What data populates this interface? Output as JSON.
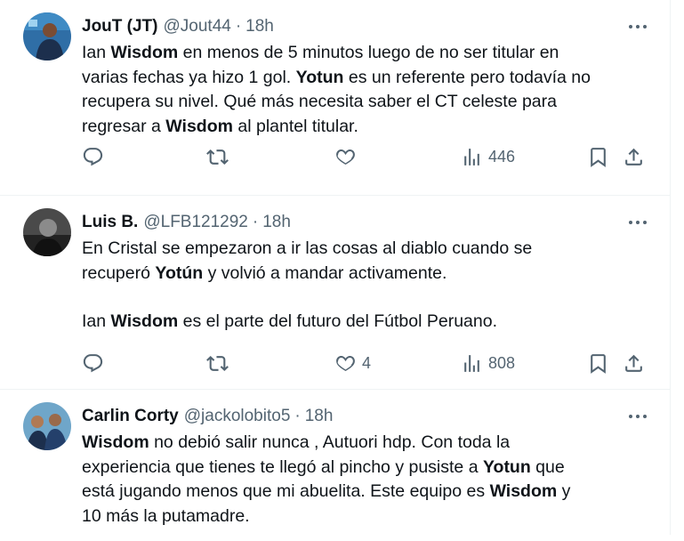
{
  "tweets": [
    {
      "name": "JouT (JT)",
      "handle": "@Jout44",
      "dot": "·",
      "time": "18h",
      "lines": [
        [
          {
            "t": "Ian "
          },
          {
            "b": "Wisdom"
          },
          {
            "t": " en menos de 5 minutos luego de no ser titular en"
          }
        ],
        [
          {
            "t": "varias fechas ya hizo 1 gol. "
          },
          {
            "b": "Yotun"
          },
          {
            "t": " es un referente pero todavía no"
          }
        ],
        [
          {
            "t": "recupera su nivel. Qué más necesita saber el CT celeste para"
          }
        ],
        [
          {
            "t": "regresar a "
          },
          {
            "b": "Wisdom"
          },
          {
            "t": " al plantel titular."
          }
        ]
      ],
      "likes": "",
      "views": "446"
    },
    {
      "name": "Luis B.",
      "handle": "@LFB121292",
      "dot": "·",
      "time": "18h",
      "lines": [
        [
          {
            "t": "En Cristal se empezaron a ir las cosas al diablo cuando se"
          }
        ],
        [
          {
            "t": "recuperó "
          },
          {
            "b": "Yotún"
          },
          {
            "t": " y volvió a mandar activamente."
          }
        ],
        [],
        [
          {
            "t": "Ian "
          },
          {
            "b": "Wisdom"
          },
          {
            "t": " es el parte del futuro del Fútbol Peruano."
          }
        ]
      ],
      "likes": "4",
      "views": "808"
    },
    {
      "name": "Carlin Corty",
      "handle": "@jackolobito5",
      "dot": "·",
      "time": "18h",
      "lines": [
        [
          {
            "b": "Wisdom"
          },
          {
            "t": " no debió salir nunca , Autuori hdp. Con toda la"
          }
        ],
        [
          {
            "t": "experiencia que tienes te llegó al pincho y pusiste a "
          },
          {
            "b": "Yotun"
          },
          {
            "t": " que"
          }
        ],
        [
          {
            "t": "está jugando menos que mi abuelita. Este equipo es "
          },
          {
            "b": "Wisdom"
          },
          {
            "t": " y"
          }
        ],
        [
          {
            "t": "10 más la putamadre."
          }
        ]
      ]
    }
  ],
  "icons": {
    "more": "more-horizontal-icon",
    "reply": "reply-icon",
    "retweet": "retweet-icon",
    "like": "like-heart-icon",
    "views": "views-chart-icon",
    "bookmark": "bookmark-icon",
    "share": "share-icon"
  }
}
